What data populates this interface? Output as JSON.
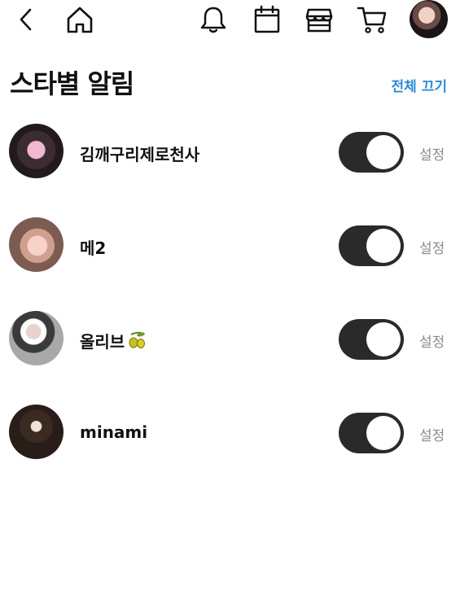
{
  "header": {
    "title": "스타별 알림",
    "turn_off_all": "전체 끄기"
  },
  "stars": [
    {
      "name": "김깨구리제로천사",
      "enabled": true,
      "settings_label": "설정"
    },
    {
      "name": "메2",
      "enabled": true,
      "settings_label": "설정"
    },
    {
      "name": "올리브",
      "enabled": true,
      "settings_label": "설정",
      "emoji": "olive-icon"
    },
    {
      "name": "minami",
      "enabled": true,
      "settings_label": "설정"
    }
  ],
  "colors": {
    "accent": "#2d8ad8",
    "toggle_on": "#2a2a2a",
    "muted_text": "#8a8a8a"
  },
  "icons": [
    "back-icon",
    "home-icon",
    "bell-icon",
    "calendar-icon",
    "store-icon",
    "cart-icon"
  ]
}
